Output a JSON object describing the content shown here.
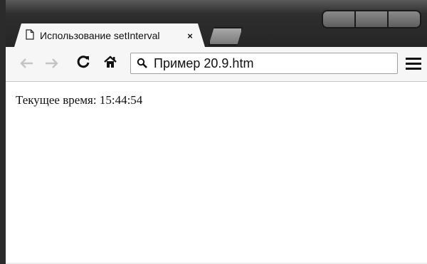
{
  "browser": {
    "tab": {
      "title": "Использование setInterval",
      "close_label": "×"
    },
    "address_bar": {
      "value": "Пример 20.9.htm"
    }
  },
  "icons": {
    "tab": "document-icon",
    "back": "back-arrow-icon",
    "forward": "forward-arrow-icon",
    "reload": "reload-icon",
    "home": "home-icon",
    "search": "search-icon",
    "menu": "menu-icon"
  },
  "page": {
    "label": "Текущее время:",
    "time": "15:44:54"
  }
}
